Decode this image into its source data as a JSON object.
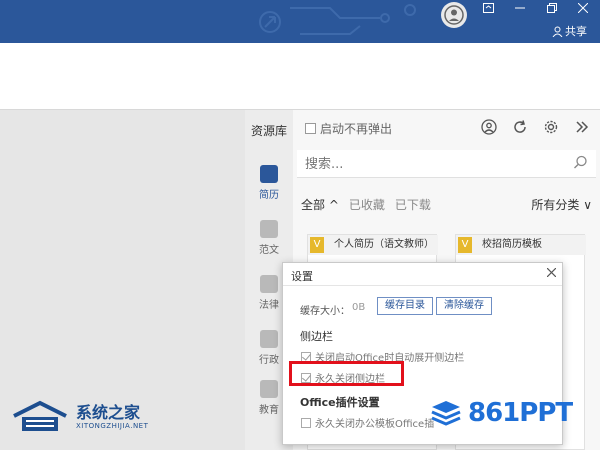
{
  "titlebar": {
    "share_label": "共享"
  },
  "panel": {
    "title": "资源库",
    "no_popup_label": "启动不再弹出",
    "rail": [
      {
        "label": "简历"
      },
      {
        "label": "范文"
      },
      {
        "label": "法律"
      },
      {
        "label": "行政"
      },
      {
        "label": "教育"
      }
    ],
    "search_placeholder": "搜索...",
    "filters": [
      {
        "label": "全部 ^"
      },
      {
        "label": "已收藏"
      },
      {
        "label": "已下载"
      }
    ],
    "category_label": "所有分类 ∨",
    "cards": [
      {
        "tag": "V",
        "title": "个人简历（语文教师）"
      },
      {
        "tag": "V",
        "title": "校招简历模板"
      }
    ]
  },
  "dialog": {
    "title": "设置",
    "cache_label": "缓存大小：",
    "cache_value": "0B",
    "cache_dir_button": "缓存目录",
    "clear_cache_button": "清除缓存",
    "sidebar_section": "侧边栏",
    "opt_close_on_start": "关闭启动Office时自动展开侧边栏",
    "opt_permanent_close": "永久关闭侧边栏",
    "plugin_section": "Office插件设置",
    "opt_close_template": "永久关闭办公模板Office插"
  },
  "watermark": {
    "left_name": "系统之家",
    "left_url": "XITONGZHIJIA.NET",
    "right_brand": "861PPT"
  },
  "colors": {
    "titlebar": "#2b579a",
    "highlight": "#e2101b",
    "link_blue": "#2b579a"
  }
}
